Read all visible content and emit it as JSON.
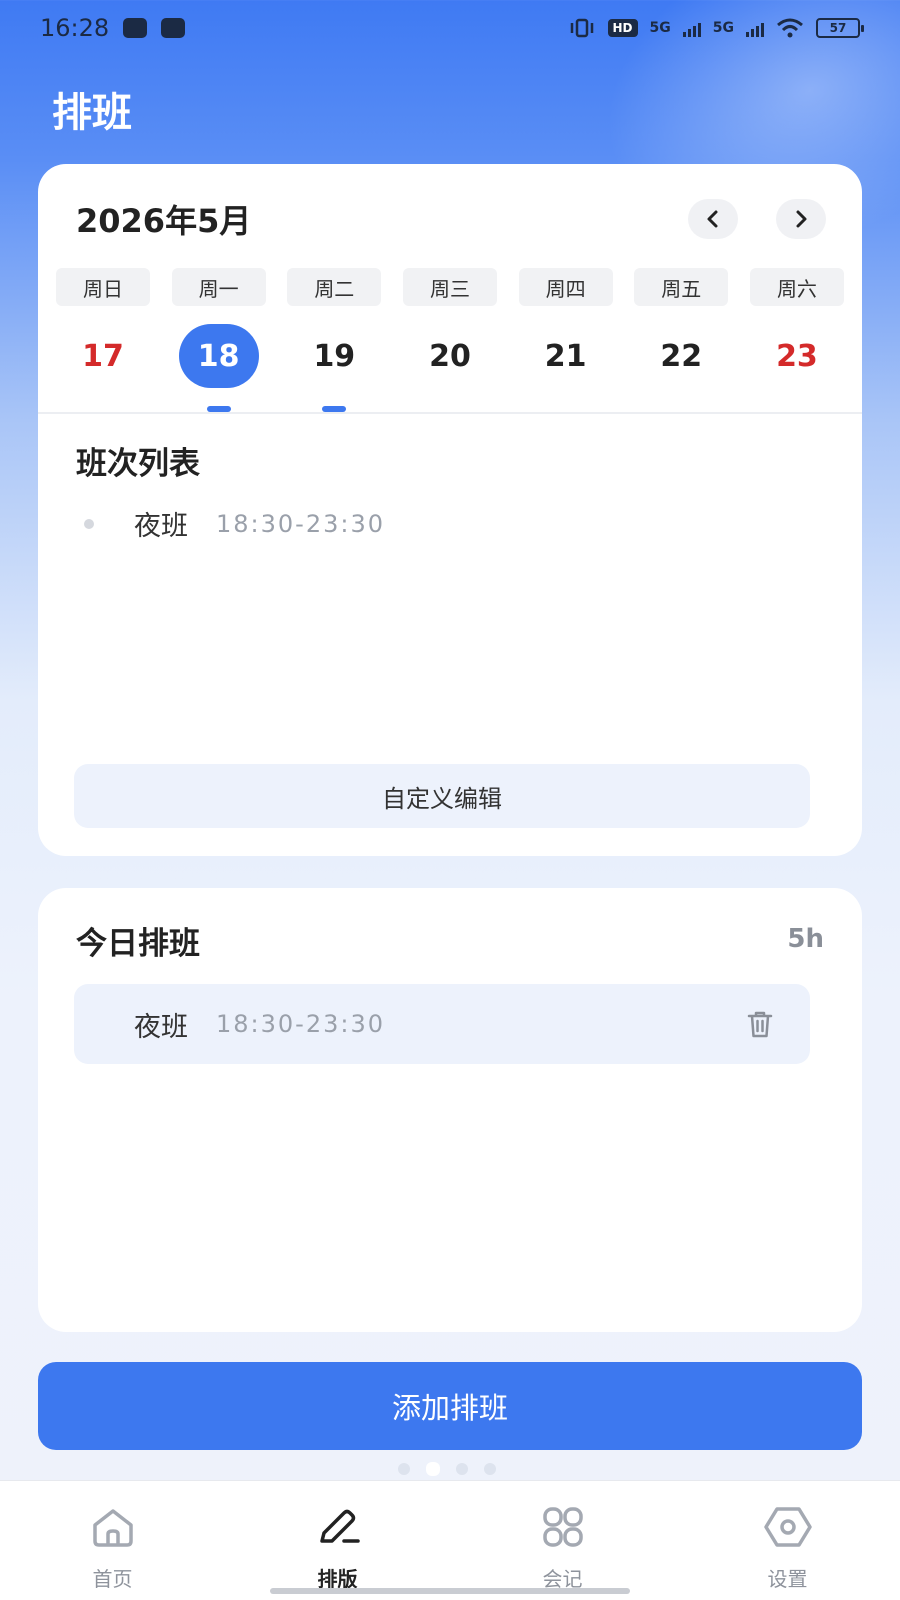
{
  "status_bar": {
    "time": "16:28",
    "network_1": "5G",
    "network_2": "5G",
    "hd_label": "HD",
    "battery": "57"
  },
  "header": {
    "title": "排班"
  },
  "calendar": {
    "month_title": "2026年5月",
    "prev_icon": "chevron-left-icon",
    "next_icon": "chevron-right-icon",
    "weekdays": [
      "周日",
      "周一",
      "周二",
      "周三",
      "周四",
      "周五",
      "周六"
    ],
    "days": [
      {
        "num": "17",
        "weekend": true,
        "selected": false,
        "has_shift": false
      },
      {
        "num": "18",
        "weekend": false,
        "selected": true,
        "has_shift": true
      },
      {
        "num": "19",
        "weekend": false,
        "selected": false,
        "has_shift": true
      },
      {
        "num": "20",
        "weekend": false,
        "selected": false,
        "has_shift": false
      },
      {
        "num": "21",
        "weekend": false,
        "selected": false,
        "has_shift": false
      },
      {
        "num": "22",
        "weekend": false,
        "selected": false,
        "has_shift": false
      },
      {
        "num": "23",
        "weekend": true,
        "selected": false,
        "has_shift": false
      }
    ],
    "accent_color": "#3d78ef",
    "weekend_color": "#d42a2a"
  },
  "shift_list": {
    "title": "班次列表",
    "items": [
      {
        "name": "夜班",
        "time": "18:30-23:30"
      }
    ],
    "custom_edit_label": "自定义编辑"
  },
  "today": {
    "title": "今日排班",
    "hours": "5h",
    "items": [
      {
        "name": "夜班",
        "time": "18:30-23:30",
        "delete_icon": "trash-icon"
      }
    ]
  },
  "add_button_label": "添加排班",
  "tabbar": {
    "items": [
      {
        "label": "首页",
        "icon": "home-icon",
        "active": false
      },
      {
        "label": "排版",
        "icon": "pencil-icon",
        "active": true
      },
      {
        "label": "会记",
        "icon": "grid-icon",
        "active": false
      },
      {
        "label": "设置",
        "icon": "settings-hexagon-icon",
        "active": false
      }
    ]
  }
}
